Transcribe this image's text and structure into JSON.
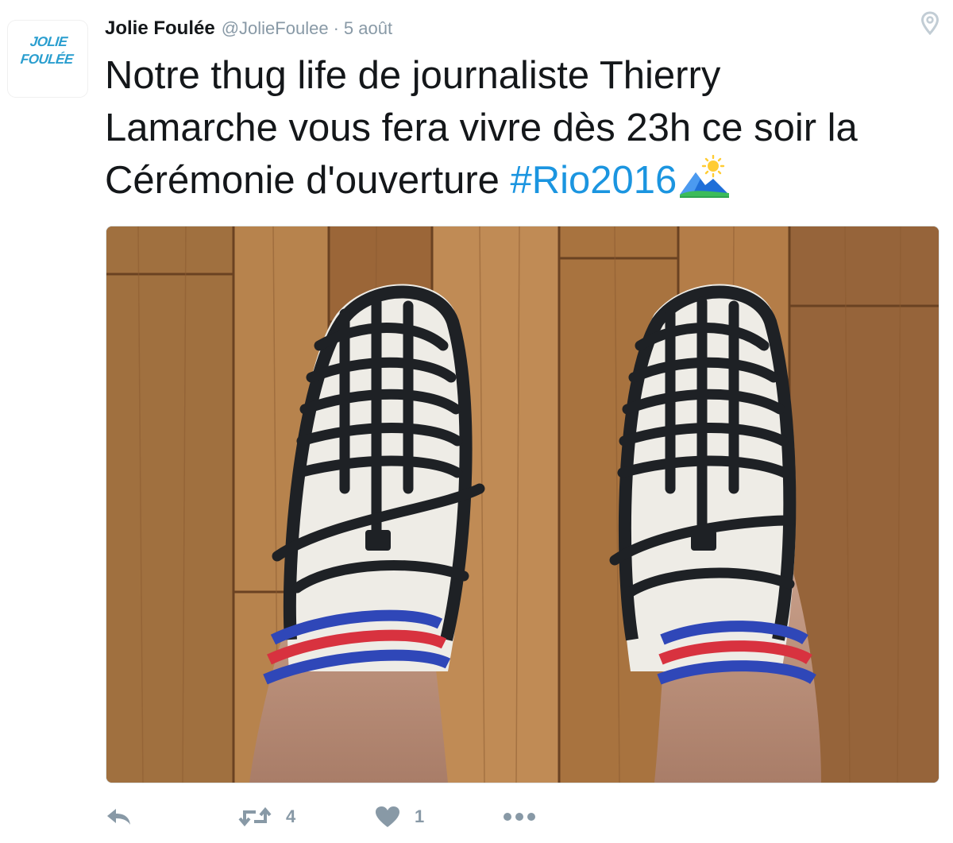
{
  "account": {
    "display_name": "Jolie Foulée",
    "handle": "@JolieFoulee",
    "separator": "·",
    "timestamp": "5 août",
    "avatar_text_line1": "JOLIE",
    "avatar_text_line2": "FOULÉE"
  },
  "tweet": {
    "line1": "Notre thug life de journaliste Thierry",
    "line2": "Lamarche vous fera vivre dès 23h ce soir la",
    "line3_text": "Cérémonie d'ouverture ",
    "hashtag": "#Rio2016",
    "emoji_icon": "sunrise-over-mountains-icon"
  },
  "media": {
    "subject_icon": "photo-sandals-socks"
  },
  "actions": {
    "reply_icon": "reply-icon",
    "retweet_icon": "retweet-icon",
    "retweet_count": "4",
    "like_icon": "heart-icon",
    "like_count": "1",
    "more_icon": "more-dots-icon"
  },
  "colors": {
    "link": "#1b95e0",
    "muted": "#8899a6",
    "text": "#14171a",
    "avatar_brand": "#2a9ecf"
  }
}
